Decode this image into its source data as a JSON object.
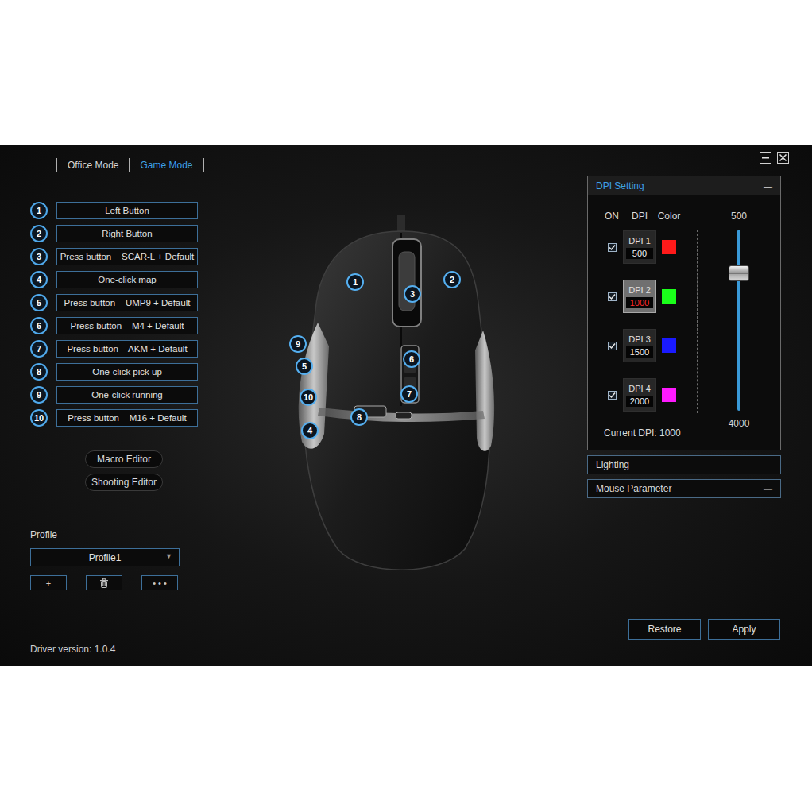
{
  "tabs": [
    {
      "label": "Office Mode",
      "selected": false
    },
    {
      "label": "Game Mode",
      "selected": true
    }
  ],
  "buttons": [
    {
      "number": "1",
      "label": "Left Button"
    },
    {
      "number": "2",
      "label": "Right Button"
    },
    {
      "number": "3",
      "label": "Press button    SCAR-L + Default"
    },
    {
      "number": "4",
      "label": "One-click map"
    },
    {
      "number": "5",
      "label": "Press button    UMP9 + Default"
    },
    {
      "number": "6",
      "label": "Press button    M4 + Default"
    },
    {
      "number": "7",
      "label": "Press button    AKM + Default"
    },
    {
      "number": "8",
      "label": "One-click pick up"
    },
    {
      "number": "9",
      "label": "One-click running"
    },
    {
      "number": "10",
      "label": "Press button    M16 + Default"
    }
  ],
  "editors": [
    "Macro Editor",
    "Shooting Editor"
  ],
  "profile": {
    "label": "Profile",
    "value": "Profile1",
    "arrow": "▼",
    "actions": [
      {
        "kind": "glyph",
        "label": "+"
      },
      {
        "kind": "trash",
        "label": ""
      },
      {
        "kind": "glyph",
        "label": "• • •"
      }
    ]
  },
  "driver_version": "Driver version: 1.0.4",
  "dpi": {
    "title": "DPI Setting",
    "collapse": "—",
    "columns": [
      "ON",
      "DPI",
      "Color"
    ],
    "rows": [
      {
        "label": "DPI 1",
        "value": "500",
        "on": true,
        "selected": false,
        "color": "#ff1a1a"
      },
      {
        "label": "DPI 2",
        "value": "1000",
        "on": true,
        "selected": true,
        "color": "#1aff1a"
      },
      {
        "label": "DPI 3",
        "value": "1500",
        "on": true,
        "selected": false,
        "color": "#1a1aff"
      },
      {
        "label": "DPI 4",
        "value": "2000",
        "on": true,
        "selected": false,
        "color": "#ff1aff"
      }
    ],
    "slider": {
      "min": "500",
      "max": "4000",
      "level": 0.24
    },
    "current": "Current DPI: 1000"
  },
  "panels": [
    {
      "title": "Lighting",
      "collapse": "—",
      "expanded": false
    },
    {
      "title": "Mouse Parameter",
      "collapse": "—",
      "expanded": false
    }
  ],
  "actions": [
    "Restore",
    "Apply"
  ]
}
